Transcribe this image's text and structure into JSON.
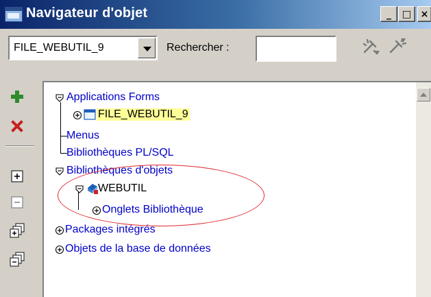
{
  "window": {
    "title": "Navigateur d'objet",
    "icon": "app-window-icon",
    "controls": {
      "minimize": "_",
      "maximize": "□",
      "close": "×"
    }
  },
  "toolbar": {
    "module_select": {
      "value": "FILE_WEBUTIL_9"
    },
    "search_label": "Rechercher :",
    "search_value": "",
    "icons": [
      "flashlight-find-previous-icon",
      "flashlight-find-next-icon"
    ]
  },
  "side_toolbar": {
    "buttons": [
      "create-plus-icon",
      "delete-x-icon",
      "expand-icon",
      "collapse-icon",
      "expand-all-icon",
      "collapse-all-icon"
    ]
  },
  "tree": {
    "nodes": [
      {
        "label": "Applications Forms",
        "state": "expanded"
      },
      {
        "label": "FILE_WEBUTIL_9",
        "state": "collapsed",
        "highlighted": true,
        "icon": "form-module-icon"
      },
      {
        "label": "Menus",
        "state": "leaf"
      },
      {
        "label": "Bibliothèques PL/SQL",
        "state": "leaf"
      },
      {
        "label": "Bibliothèques d'objets",
        "state": "expanded"
      },
      {
        "label": "WEBUTIL",
        "state": "expanded",
        "icon": "object-library-icon"
      },
      {
        "label": "Onglets Bibliothèque",
        "state": "collapsed"
      },
      {
        "label": "Packages intégrés",
        "state": "collapsed"
      },
      {
        "label": "Objets de la base de données",
        "state": "collapsed"
      }
    ]
  },
  "annotation": {
    "color": "#e0262b"
  },
  "colors": {
    "node_text": "#0000c8",
    "highlight": "#ffff99",
    "titlebar_start": "#0a246a",
    "titlebar_end": "#a6caf0"
  }
}
